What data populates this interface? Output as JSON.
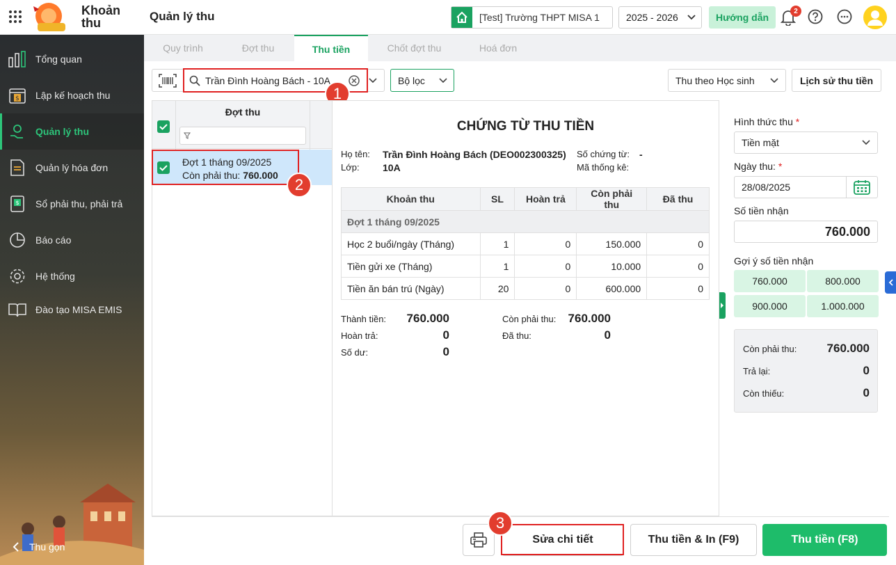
{
  "app": {
    "name": "Khoản thu",
    "page_title": "Quản lý thu",
    "school": "[Test] Trường THPT MISA 1",
    "year": "2025 - 2026",
    "guide_button": "Hướng dẫn",
    "notification_count": "2"
  },
  "sidebar": {
    "items": [
      {
        "label": "Tổng quan",
        "icon": "dashboard-icon"
      },
      {
        "label": "Lập kế hoạch thu",
        "icon": "calendar-money-icon"
      },
      {
        "label": "Quản lý thu",
        "icon": "hand-money-icon"
      },
      {
        "label": "Quản lý hóa đơn",
        "icon": "invoice-icon"
      },
      {
        "label": "Sổ phải thu, phải trả",
        "icon": "ledger-icon"
      },
      {
        "label": "Báo cáo",
        "icon": "pie-chart-icon"
      },
      {
        "label": "Hệ thống",
        "icon": "gear-icon"
      },
      {
        "label": "Đào tạo MISA EMIS",
        "icon": "book-icon"
      }
    ],
    "collapse": "Thu gọn"
  },
  "tabs": [
    "Quy trình",
    "Đợt thu",
    "Thu tiền",
    "Chốt đợt thu",
    "Hoá đơn"
  ],
  "search": {
    "value": "Trần Đình Hoàng Bách - 10A"
  },
  "filter": {
    "label": "Bộ lọc"
  },
  "collect_mode": "Thu theo Học sinh",
  "history_button": "Lịch sử thu tiền",
  "batch_list": {
    "header": "Đợt thu",
    "row": {
      "name": "Đợt 1 tháng 09/2025",
      "remain_label": "Còn phải thu:",
      "remain_value": "760.000"
    }
  },
  "voucher": {
    "title": "CHỨNG TỪ THU TIỀN",
    "name_label": "Họ tên:",
    "name_value": "Trần Đình Hoàng Bách (DEO002300325)",
    "class_label": "Lớp:",
    "class_value": "10A",
    "doc_label": "Số chứng từ:",
    "doc_value": "-",
    "stat_label": "Mã thống kê:",
    "columns": [
      "Khoản thu",
      "SL",
      "Hoàn trả",
      "Còn phải thu",
      "Đã thu"
    ],
    "group": "Đợt 1 tháng 09/2025",
    "rows": [
      [
        "Học 2 buổi/ngày (Tháng)",
        "1",
        "0",
        "150.000",
        "0"
      ],
      [
        "Tiền gửi xe (Tháng)",
        "1",
        "0",
        "10.000",
        "0"
      ],
      [
        "Tiền ăn bán trú (Ngày)",
        "20",
        "0",
        "600.000",
        "0"
      ]
    ],
    "total_label": "Thành tiền:",
    "total_value": "760.000",
    "refund_label": "Hoàn trả:",
    "refund_value": "0",
    "balance_label": "Số dư:",
    "balance_value": "0",
    "remain_label": "Còn phải thu:",
    "remain_value": "760.000",
    "paid_label": "Đã thu:",
    "paid_value": "0"
  },
  "payment": {
    "method_label": "Hình thức thu",
    "method_value": "Tiền mặt",
    "date_label": "Ngày thu:",
    "date_value": "28/08/2025",
    "received_label": "Số tiền nhận",
    "received_value": "760.000",
    "suggest_label": "Gợi ý số tiền nhận",
    "suggestions": [
      "760.000",
      "800.000",
      "900.000",
      "1.000.000"
    ],
    "summary": [
      {
        "label": "Còn phải thu:",
        "value": "760.000"
      },
      {
        "label": "Trả lại:",
        "value": "0"
      },
      {
        "label": "Còn thiếu:",
        "value": "0"
      }
    ]
  },
  "footer": {
    "edit": "Sửa chi tiết",
    "collect_print": "Thu tiền & In (F9)",
    "collect": "Thu tiền (F8)"
  },
  "step_badges": [
    "1",
    "2",
    "3"
  ],
  "colors": {
    "accent": "#1aa260",
    "highlight_red": "#e02020",
    "badge": "#e23d2e"
  }
}
